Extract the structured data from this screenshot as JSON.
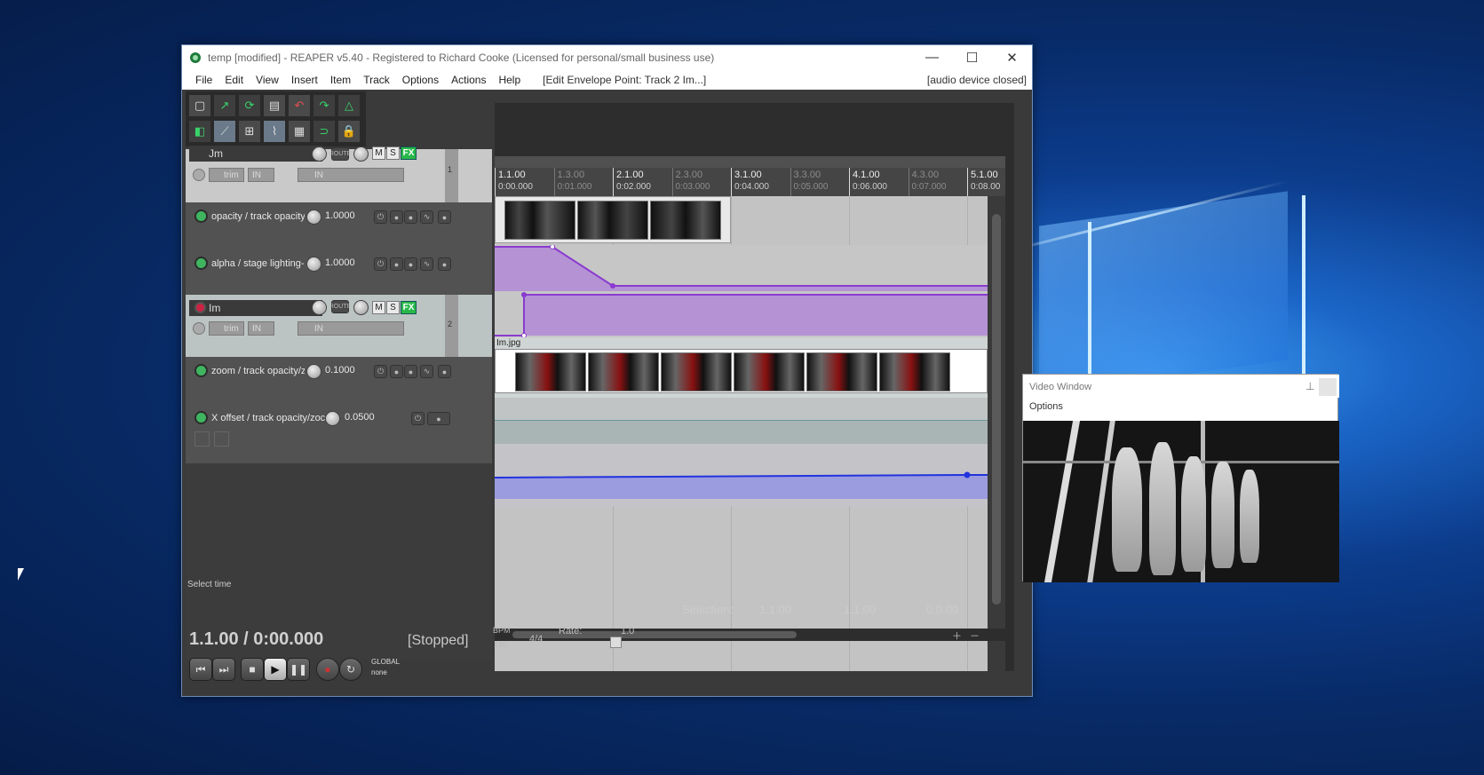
{
  "window": {
    "title": "temp [modified] - REAPER v5.40 - Registered to Richard Cooke (Licensed for personal/small business use)",
    "minimize": "—",
    "maximize": "☐",
    "close": "✕"
  },
  "menu": {
    "items": [
      "File",
      "Edit",
      "View",
      "Insert",
      "Item",
      "Track",
      "Options",
      "Actions",
      "Help"
    ],
    "action_context": "[Edit Envelope Point: Track 2 Im...]",
    "device_status": "[audio device closed]"
  },
  "tracks": [
    {
      "name": "Jm",
      "number": "1",
      "trim": "trim",
      "in1": "IN",
      "in2": "IN",
      "route": "ROUTE",
      "mute": "M",
      "solo": "S",
      "fx": "FX"
    },
    {
      "name": "Im",
      "number": "2",
      "trim": "trim",
      "in1": "IN",
      "in2": "IN",
      "route": "ROUTE",
      "mute": "M",
      "solo": "S",
      "fx": "FX"
    }
  ],
  "envelopes": [
    {
      "name": "opacity / track opacity",
      "value": "1.0000"
    },
    {
      "name": "alpha / stage lighting-",
      "value": "1.0000"
    },
    {
      "name": "zoom / track opacity/z",
      "value": "0.1000"
    },
    {
      "name": "X offset / track opacity/zoc",
      "value": "0.0500"
    }
  ],
  "ruler": {
    "marks": [
      {
        "bar": "1.1.00",
        "time": "0:00.000",
        "major": true
      },
      {
        "bar": "1.3.00",
        "time": "0:01.000",
        "major": false
      },
      {
        "bar": "2.1.00",
        "time": "0:02.000",
        "major": true
      },
      {
        "bar": "2.3.00",
        "time": "0:03.000",
        "major": false
      },
      {
        "bar": "3.1.00",
        "time": "0:04.000",
        "major": true
      },
      {
        "bar": "3.3.00",
        "time": "0:05.000",
        "major": false
      },
      {
        "bar": "4.1.00",
        "time": "0:06.000",
        "major": true
      },
      {
        "bar": "4.3.00",
        "time": "0:07.000",
        "major": false
      },
      {
        "bar": "5.1.00",
        "time": "0:08.00",
        "major": true
      }
    ]
  },
  "items": {
    "track2_item_label": "Im.jpg"
  },
  "status": {
    "select_time": "Select time",
    "position": "1.1.00 / 0:00.000",
    "state": "[Stopped]",
    "bpm_label": "BPM",
    "bpm": "120",
    "time_sig": "4/4",
    "rate_label": "Rate:",
    "rate": "1.0",
    "selection_label": "Selection:",
    "sel_start": "1.1.00",
    "sel_end": "1.1.00",
    "sel_length": "0.0.00",
    "automation_mode": "GLOBAL",
    "automation_value": "none"
  },
  "video_window": {
    "title": "Video Window",
    "menu": "Options"
  },
  "colors": {
    "envelope_fill": "#b592d4",
    "envelope_line": "#8a3ad0",
    "offset_line": "#2233dd",
    "fx_green": "#28b84a"
  }
}
